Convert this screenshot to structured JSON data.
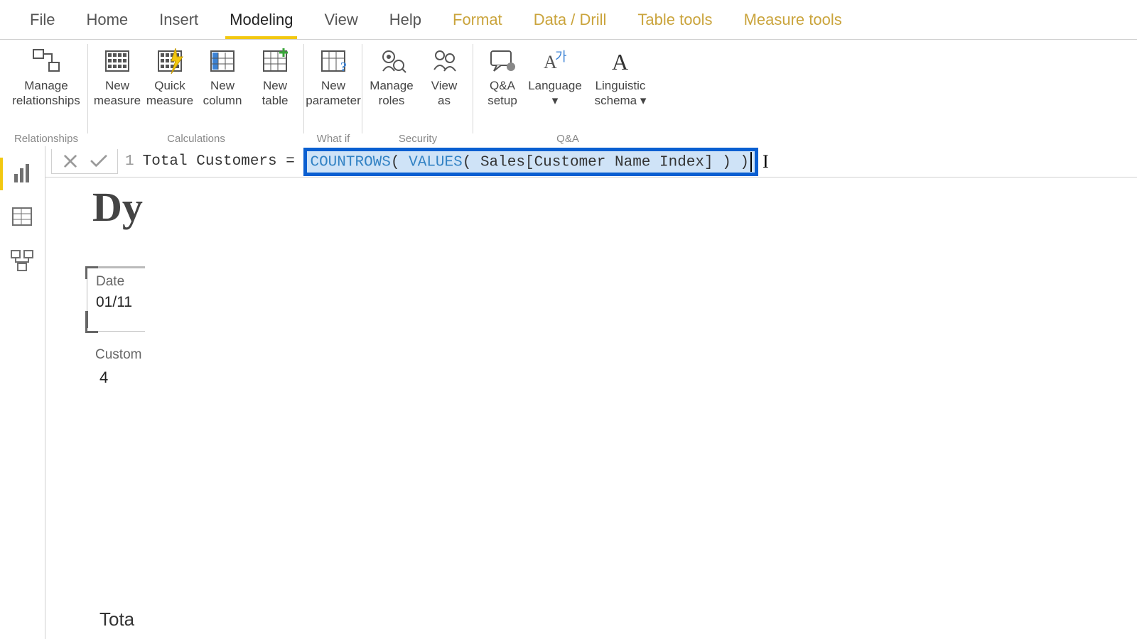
{
  "menu": {
    "items": [
      "File",
      "Home",
      "Insert",
      "Modeling",
      "View",
      "Help",
      "Format",
      "Data / Drill",
      "Table tools",
      "Measure tools"
    ],
    "active_index": 3,
    "contextual_start_index": 6
  },
  "ribbon": {
    "groups": [
      {
        "caption": "Relationships",
        "buttons": [
          {
            "name": "manage-relationships",
            "label": "Manage\nrelationships",
            "icon": "relationships"
          }
        ]
      },
      {
        "caption": "Calculations",
        "buttons": [
          {
            "name": "new-measure",
            "label": "New\nmeasure",
            "icon": "measure"
          },
          {
            "name": "quick-measure",
            "label": "Quick\nmeasure",
            "icon": "quick-measure"
          },
          {
            "name": "new-column",
            "label": "New\ncolumn",
            "icon": "column"
          },
          {
            "name": "new-table",
            "label": "New\ntable",
            "icon": "table"
          }
        ]
      },
      {
        "caption": "What if",
        "buttons": [
          {
            "name": "new-parameter",
            "label": "New\nparameter",
            "icon": "parameter"
          }
        ]
      },
      {
        "caption": "Security",
        "buttons": [
          {
            "name": "manage-roles",
            "label": "Manage\nroles",
            "icon": "roles"
          },
          {
            "name": "view-as",
            "label": "View\nas",
            "icon": "view-as"
          }
        ]
      },
      {
        "caption": "Q&A",
        "buttons": [
          {
            "name": "qa-setup",
            "label": "Q&A\nsetup",
            "icon": "qa"
          },
          {
            "name": "language",
            "label": "Language\n▾",
            "icon": "language"
          },
          {
            "name": "linguistic-schema",
            "label": "Linguistic\nschema ▾",
            "icon": "schema"
          }
        ]
      }
    ]
  },
  "rail": {
    "items": [
      {
        "name": "report-view",
        "icon": "chart",
        "active": true
      },
      {
        "name": "data-view",
        "icon": "grid"
      },
      {
        "name": "model-view",
        "icon": "model"
      }
    ]
  },
  "formula": {
    "line": "1",
    "measure_name": "Total Customers",
    "equals": "=",
    "expr": {
      "func1": "COUNTROWS",
      "open1": "( ",
      "func2": "VALUES",
      "open2": "( ",
      "ref": "Sales[Customer Name Index]",
      "close2": " )",
      "close1": " )"
    }
  },
  "canvas": {
    "title_fragment": "Dy",
    "slicer1": {
      "label": "Date",
      "value": "01/11"
    },
    "slicer2": {
      "label": "Custom",
      "value": "4"
    },
    "bottom_fragment": "Tota"
  }
}
